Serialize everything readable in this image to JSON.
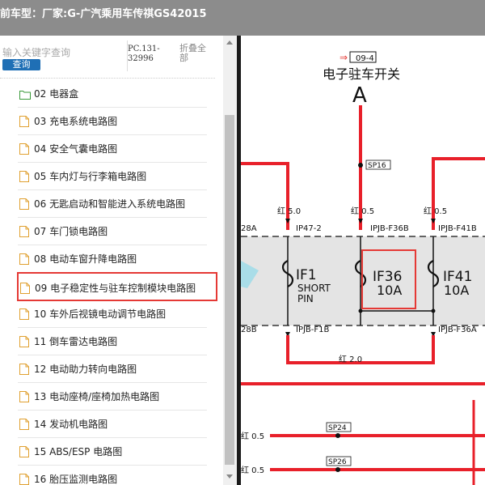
{
  "header": {
    "title": "前车型：厂家:G-广汽乘用车传祺GS42015"
  },
  "sidebar": {
    "search_placeholder": "输入关键字查询",
    "query_button": "查询",
    "code": "PC.131-32996",
    "collapse_all": "折叠全部",
    "items": [
      {
        "label": "02 电器盒",
        "icon": "folder-icon"
      },
      {
        "label": "03 充电系统电路图",
        "icon": "document-icon"
      },
      {
        "label": "04 安全气囊电路图",
        "icon": "document-icon"
      },
      {
        "label": "05 车内灯与行李箱电路图",
        "icon": "document-icon"
      },
      {
        "label": "06 无匙启动和智能进入系统电路图",
        "icon": "document-icon"
      },
      {
        "label": "07 车门锁电路图",
        "icon": "document-icon"
      },
      {
        "label": "08 电动车窗升降电路图",
        "icon": "document-icon"
      },
      {
        "label": "09 电子稳定性与驻车控制模块电路图",
        "icon": "document-icon",
        "selected": true
      },
      {
        "label": "10 车外后视镜电动调节电路图",
        "icon": "document-icon"
      },
      {
        "label": "11 倒车雷达电路图",
        "icon": "document-icon"
      },
      {
        "label": "12 电动助力转向电路图",
        "icon": "document-icon"
      },
      {
        "label": "13 电动座椅/座椅加热电路图",
        "icon": "document-icon"
      },
      {
        "label": "14 发动机电路图",
        "icon": "document-icon"
      },
      {
        "label": "15 ABS/ESP 电路图",
        "icon": "document-icon"
      },
      {
        "label": "16 胎压监测电路图",
        "icon": "document-icon"
      }
    ]
  },
  "diagram": {
    "page_ref": "09-4",
    "switch_title": "电子驻车开关",
    "connector": "A",
    "splice_top": "SP16",
    "wires": [
      {
        "label": "红 5.0",
        "pin": "IP47-2"
      },
      {
        "label": "红 0.5",
        "pin": "IPJB-F36B"
      },
      {
        "label": "红 0.5",
        "pin": "IPJB-F41B"
      }
    ],
    "left_cut_top": "28A",
    "left_cut_bottom": "28B",
    "fuses": [
      {
        "id": "IF1",
        "rating": "SHORT",
        "rating2": "PIN"
      },
      {
        "id": "IF36",
        "rating": "10A"
      },
      {
        "id": "IF41",
        "rating": "10A"
      }
    ],
    "bottom_pins": [
      "IPJB-F1B",
      "IPJB-F36A"
    ],
    "bus_label": "红 2.0",
    "lower_wires": [
      {
        "label": "红 0.5",
        "splice": "SP24"
      },
      {
        "label": "红 0.5",
        "splice": "SP26"
      }
    ],
    "colors": {
      "wire": "#e8202a",
      "highlight": "#e53935",
      "fuse_box": "#e4e4e4",
      "accent": "#1f6fb5"
    }
  }
}
